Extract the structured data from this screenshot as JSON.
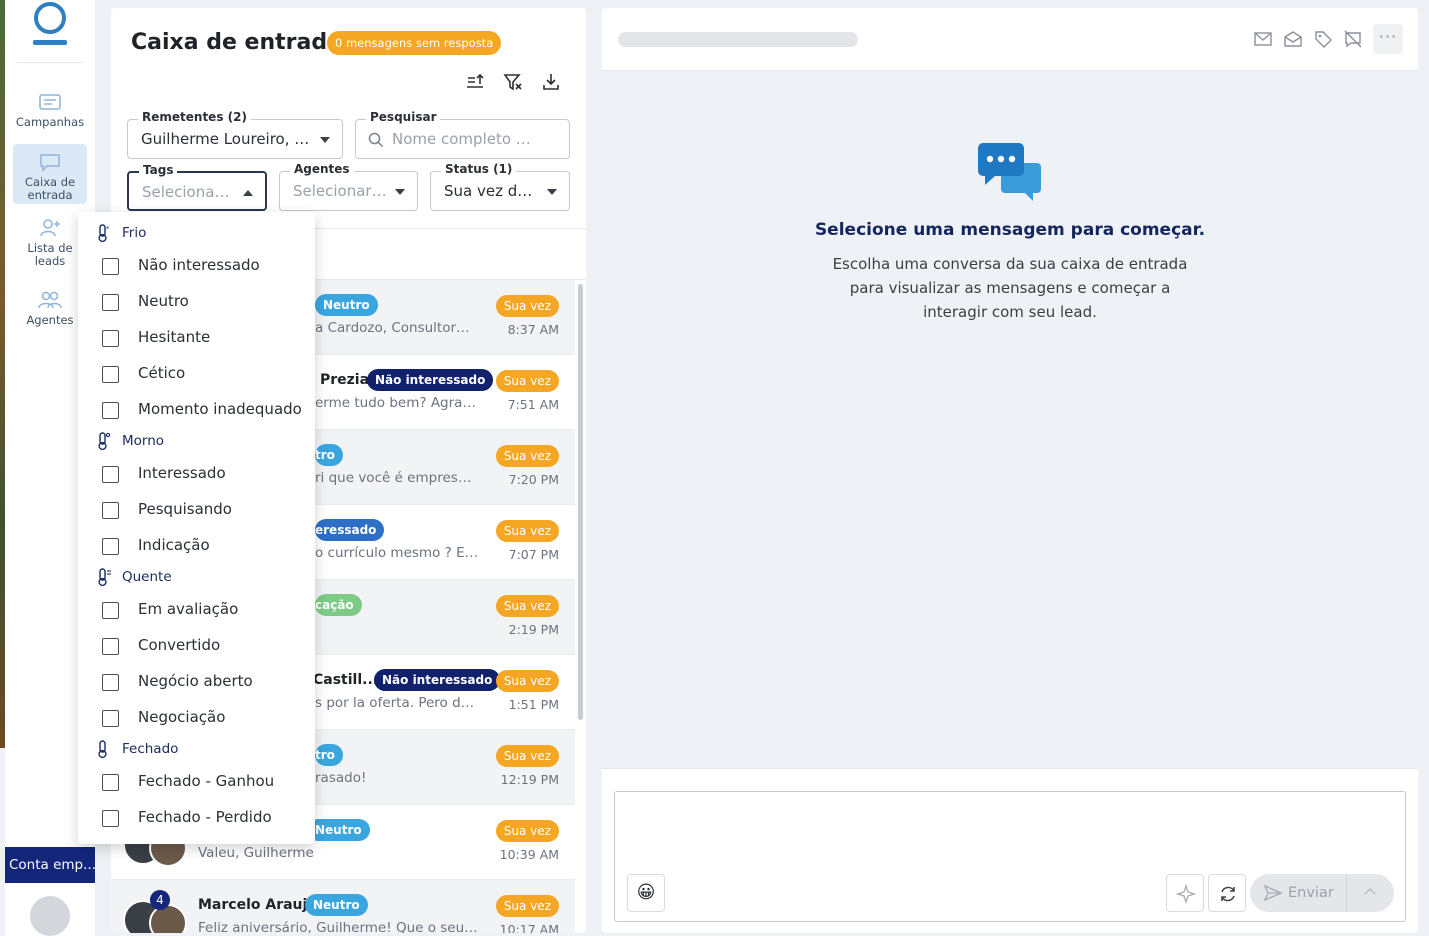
{
  "sidebar": {
    "items": [
      {
        "label": "Campanhas",
        "icon": "campaign-icon"
      },
      {
        "label": "Caixa de entrada",
        "icon": "inbox-icon"
      },
      {
        "label": "Lista de leads",
        "icon": "add-lead-icon"
      },
      {
        "label": "Agentes",
        "icon": "agents-icon"
      }
    ],
    "account_label": "Conta emp..."
  },
  "inbox": {
    "title": "Caixa de entrada",
    "unread_badge": "0 mensagens sem resposta",
    "filters": {
      "remetentes": {
        "label": "Remetentes (2)",
        "value": "Guilherme Loureiro, A..."
      },
      "pesquisar": {
        "label": "Pesquisar",
        "placeholder": "Nome completo do per"
      },
      "tags": {
        "label": "Tags",
        "placeholder": "Selecionar ..."
      },
      "agentes": {
        "label": "Agentes",
        "placeholder": "Selecionar ..."
      },
      "status": {
        "label": "Status (1)",
        "value": "Sua vez de ..."
      }
    },
    "rows": [
      {
        "name": "",
        "tag": "Neutro",
        "preview": "a Cardozo, Consultora d...",
        "status": "Sua vez",
        "time": "8:37 AM"
      },
      {
        "name": "Prezia",
        "tag": "Não interessado",
        "preview": "erme tudo bem? Agradeç...",
        "status": "Sua vez",
        "time": "7:51 AM"
      },
      {
        "name": "",
        "tag": "tro",
        "preview": "ri que você é empresário ...",
        "status": "Sua vez",
        "time": "7:20 PM"
      },
      {
        "name": "",
        "tag": "eressado",
        "preview": "o currículo mesmo ? E só ...",
        "status": "Sua vez",
        "time": "7:07 PM"
      },
      {
        "name": "",
        "tag": "cação",
        "preview": "",
        "status": "Sua vez",
        "time": "2:19 PM"
      },
      {
        "name": "Castill...",
        "tag": "Não interessado",
        "preview": "s por la oferta. Pero don...",
        "status": "Sua vez",
        "time": "1:51 PM"
      },
      {
        "name": "",
        "tag": "tro",
        "preview": "rasado!",
        "status": "Sua vez",
        "time": "12:19 PM"
      },
      {
        "name": "",
        "tag": "Neutro",
        "preview": "Valeu, Guilherme",
        "status": "Sua vez",
        "time": "10:39 AM"
      },
      {
        "name": "Marcelo Araujo",
        "tag": "Neutro",
        "preview": "Feliz aniversário, Guilherme! Que o seu dia ...",
        "status": "Sua vez",
        "time": "10:17 AM",
        "count": "4"
      }
    ]
  },
  "dropdown": {
    "groups": [
      {
        "name": "Frio",
        "options": [
          "Não interessado",
          "Neutro",
          "Hesitante",
          "Cético",
          "Momento inadequado"
        ]
      },
      {
        "name": "Morno",
        "options": [
          "Interessado",
          "Pesquisando",
          "Indicação"
        ]
      },
      {
        "name": "Quente",
        "options": [
          "Em avaliação",
          "Convertido",
          "Negócio aberto",
          "Negociação"
        ]
      },
      {
        "name": "Fechado",
        "options": [
          "Fechado - Ganhou",
          "Fechado - Perdido"
        ]
      }
    ]
  },
  "message_panel": {
    "empty_title": "Selecione uma mensagem para começar.",
    "empty_subtitle": "Escolha uma conversa da sua caixa de entrada para visualizar as mensagens e começar a interagir com seu lead.",
    "more_label": "···",
    "emoji": "😀",
    "send_label": "Enviar"
  },
  "colors": {
    "brand": "#2d7fc1",
    "navy": "#13267a",
    "accent_orange": "#f5a623"
  }
}
